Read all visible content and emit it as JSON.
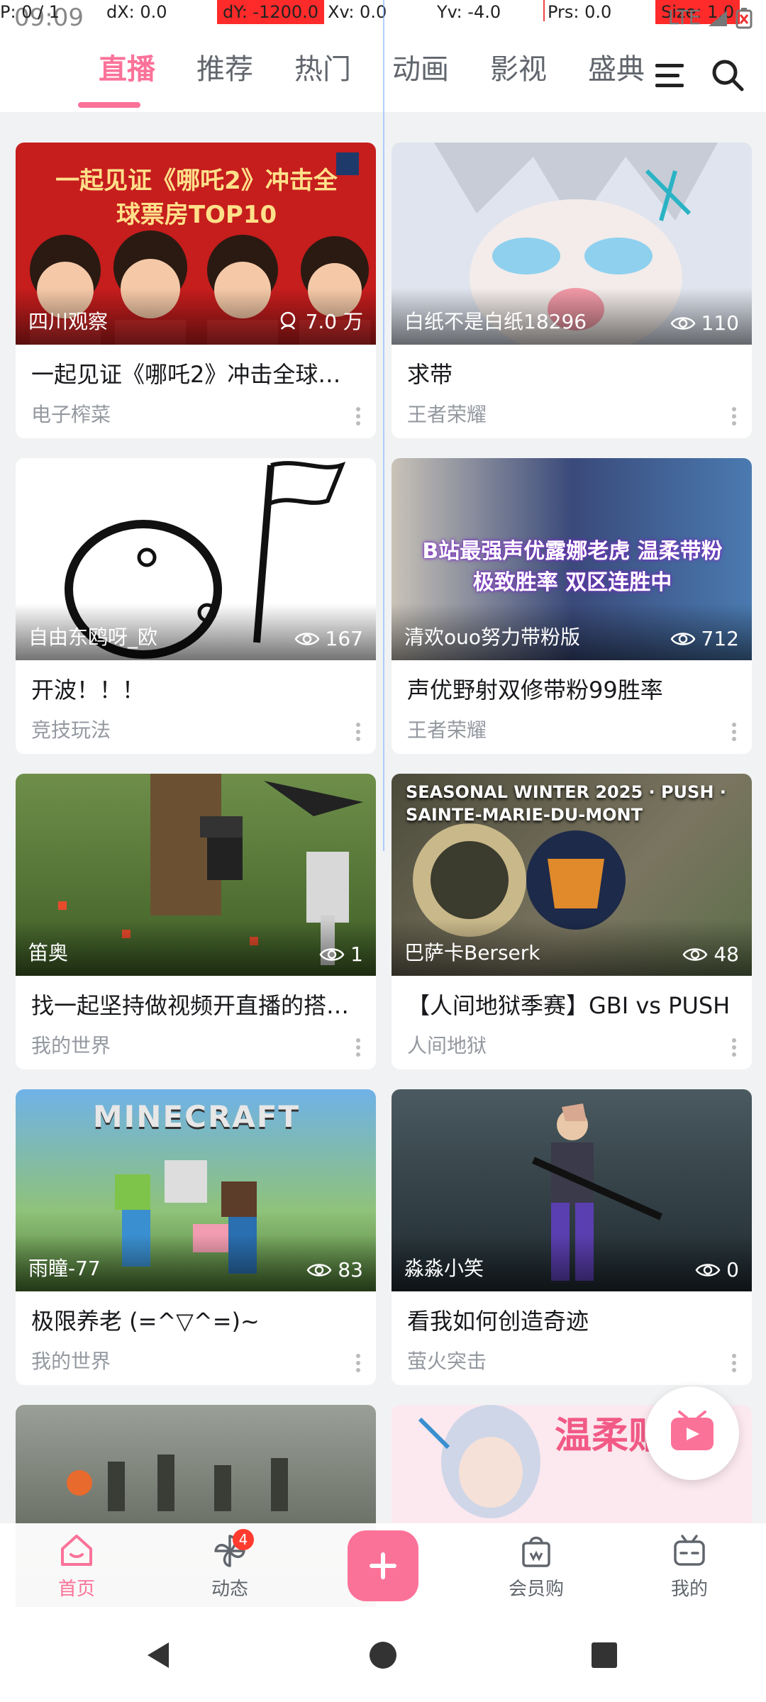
{
  "status_bar": {
    "time": "09:09",
    "p": "P: 0 / 1",
    "dx": "dX: 0.0",
    "dy": "dY: -1200.0",
    "xv": "Xv: 0.0",
    "yv": "Yv: -4.0",
    "prs": "Prs: 0.0",
    "size": "Size: 1.0",
    "network": "LTE"
  },
  "tabs": [
    {
      "label": "直播",
      "active": true
    },
    {
      "label": "推荐",
      "active": false
    },
    {
      "label": "热门",
      "active": false
    },
    {
      "label": "动画",
      "active": false
    },
    {
      "label": "影视",
      "active": false
    },
    {
      "label": "盛典",
      "active": false
    }
  ],
  "cards": [
    {
      "title": "一起见证《哪吒2》冲击全球票…",
      "category": "电子榨菜",
      "uploader": "四川观察",
      "views": "7.0 万",
      "thumb_text": "一起见证《哪吒2》冲击全球票房TOP10",
      "thumb_color": "#c61d1d"
    },
    {
      "title": "求带",
      "category": "王者荣耀",
      "uploader": "白纸不是白纸18296",
      "views": "110",
      "thumb_text": "",
      "thumb_color": "#dfe4ee"
    },
    {
      "title": "开波！！！",
      "category": "竞技玩法",
      "uploader": "自由东鸥呀_欧",
      "views": "167",
      "thumb_text": "",
      "thumb_color": "#ffffff"
    },
    {
      "title": "声优野射双修带粉99胜率",
      "category": "王者荣耀",
      "uploader": "清欢ouo努力带粉版",
      "views": "712",
      "thumb_text": "B站最强声优露娜老虎 温柔带粉极致胜率 双区连胜中",
      "thumb_color": "#3a4a7a"
    },
    {
      "title": "找一起坚持做视频开直播的搭…",
      "category": "我的世界",
      "uploader": "笛奥",
      "views": "1",
      "thumb_text": "",
      "thumb_color": "#4d6b2e"
    },
    {
      "title": "【人间地狱季赛】GBI vs PUSH",
      "category": "人间地狱",
      "uploader": "巴萨卡Berserk",
      "views": "48",
      "thumb_text": "SEASONAL WINTER 2025 · PUSH · SAINTE-MARIE-DU-MONT",
      "thumb_color": "#5a5a48"
    },
    {
      "title": "极限养老 (=^▽^=)~",
      "category": "我的世界",
      "uploader": "雨瞳-77",
      "views": "83",
      "thumb_text": "MINECRAFT",
      "thumb_color": "#5fa0d8"
    },
    {
      "title": "看我如何创造奇迹",
      "category": "萤火突击",
      "uploader": "淼淼小笑",
      "views": "0",
      "thumb_text": "",
      "thumb_color": "#2f3a42"
    },
    {
      "title": "",
      "category": "",
      "uploader": "",
      "views": "",
      "thumb_text": "",
      "thumb_color": "#6b6e66"
    },
    {
      "title": "",
      "category": "",
      "uploader": "",
      "views": "",
      "thumb_text": "温柔贴心助",
      "thumb_color": "#fbe9ef"
    }
  ],
  "bottom_nav": [
    {
      "label": "首页",
      "icon": "home-icon",
      "active": true
    },
    {
      "label": "动态",
      "icon": "pinwheel-icon",
      "active": false,
      "badge": "4"
    },
    {
      "label": "",
      "icon": "plus-icon",
      "active": false
    },
    {
      "label": "会员购",
      "icon": "shopping-bag-icon",
      "active": false
    },
    {
      "label": "我的",
      "icon": "tv-face-icon",
      "active": false
    }
  ],
  "colors": {
    "accent": "#fb7299",
    "text": "#18191c",
    "subtext": "#9499a0",
    "background": "#f1f2f3"
  }
}
